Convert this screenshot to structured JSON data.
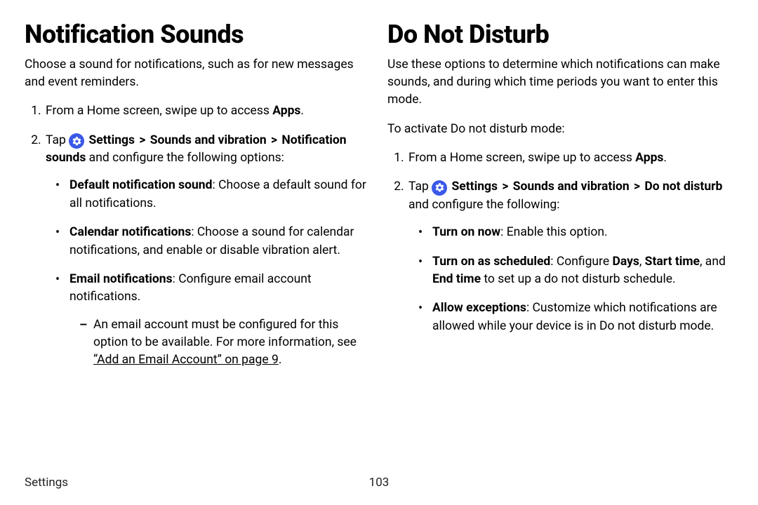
{
  "left": {
    "heading": "Notification Sounds",
    "intro": "Choose a sound for notifications, such as for new messages and event reminders.",
    "step1_pre": "From a Home screen, swipe up to access ",
    "step1_bold": "Apps",
    "step1_post": ".",
    "step2_tap": "Tap ",
    "step2_settings": "Settings",
    "step2_sep1": ">",
    "step2_sv": "Sounds and vibration",
    "step2_sep2": ">",
    "step2_ns": "Notification sounds",
    "step2_tail": " and configure the following options:",
    "b1_bold": "Default notification sound",
    "b1_tail": ": Choose a default sound for all notifications.",
    "b2_bold": "Calendar notifications",
    "b2_tail": ": Choose a sound for calendar notifications, and enable or disable vibration alert.",
    "b3_bold": "Email notifications",
    "b3_tail": ": Configure email account notifications.",
    "b3_sub_pre": "An email account must be configured for this option to be available. For more information, see ",
    "b3_sub_link": "“Add an Email Account” on page 9",
    "b3_sub_post": "."
  },
  "right": {
    "heading": "Do Not Disturb",
    "intro": "Use these options to determine which notifications can make sounds, and during which time periods you want to enter this mode.",
    "activate": "To activate Do not disturb mode:",
    "step1_pre": "From a Home screen, swipe up to access ",
    "step1_bold": "Apps",
    "step1_post": ".",
    "step2_tap": "Tap ",
    "step2_settings": "Settings",
    "step2_sep1": ">",
    "step2_sv": "Sounds and vibration",
    "step2_sep2": ">",
    "step2_dnd": "Do not disturb",
    "step2_tail": " and configure the following:",
    "b1_bold": "Turn on now",
    "b1_tail": ": Enable this option.",
    "b2_bold": "Turn on as scheduled",
    "b2_mid1": ": Configure ",
    "b2_days": "Days",
    "b2_mid2": ", ",
    "b2_start": "Start time",
    "b2_mid3": ", and ",
    "b2_end": "End time",
    "b2_tail": " to set up a do not disturb schedule.",
    "b3_bold": "Allow exceptions",
    "b3_tail": ": Customize which notifications are allowed while your device is in Do not disturb mode."
  },
  "footer": {
    "section": "Settings",
    "page": "103"
  }
}
